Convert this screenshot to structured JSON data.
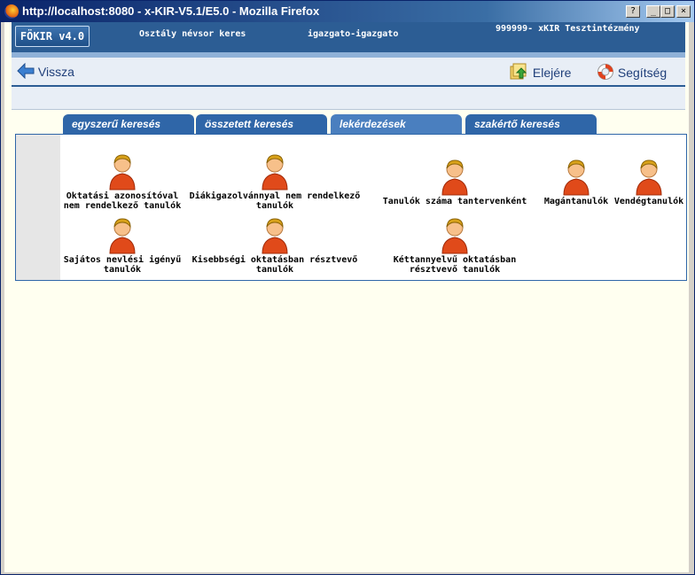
{
  "window": {
    "title": "http://localhost:8080 - x-KIR-V5.1/E5.0 - Mozilla Firefox",
    "controls": {
      "help": "?",
      "minimize": "_",
      "maximize": "□",
      "close": "×"
    }
  },
  "header": {
    "logo": "FÖKIR v4.0",
    "page_title": "Osztály névsor keres",
    "user": "igazgato-igazgato",
    "institution": "999999- xKIR Tesztintézmény"
  },
  "toolbar": {
    "back_label": "Vissza",
    "home_label": "Elejére",
    "help_label": "Segítség"
  },
  "tabs": [
    {
      "label": "egyszerű keresés",
      "active": false
    },
    {
      "label": "összetett keresés",
      "active": false
    },
    {
      "label": "lekérdezések",
      "active": true
    },
    {
      "label": "szakértő keresés",
      "active": false
    }
  ],
  "queries": [
    {
      "line1": "Oktatási azonosítóval",
      "line2": "nem rendelkező tanulók",
      "icon": "person-icon"
    },
    {
      "line1": "Diákigazolvánnyal nem rendelkező",
      "line2": "tanulók",
      "icon": "person-icon"
    },
    {
      "line1": "Tanulók száma tantervenként",
      "line2": "",
      "icon": "person-icon"
    },
    {
      "line1": "Magántanulók",
      "line2": "",
      "icon": "person-icon"
    },
    {
      "line1": "Vendégtanulók",
      "line2": "",
      "icon": "person-icon"
    },
    {
      "line1": "Sajátos nevlési igényű",
      "line2": "tanulók",
      "icon": "person-icon"
    },
    {
      "line1": "Kisebbségi oktatásban résztvevő",
      "line2": "tanulók",
      "icon": "person-icon"
    },
    {
      "line1": "Kéttannyelvű oktatásban",
      "line2": "résztvevő tanulók",
      "icon": "person-icon"
    }
  ],
  "colors": {
    "brand": "#2c5d94",
    "tab": "#2f66a8",
    "background": "#fffff0"
  }
}
